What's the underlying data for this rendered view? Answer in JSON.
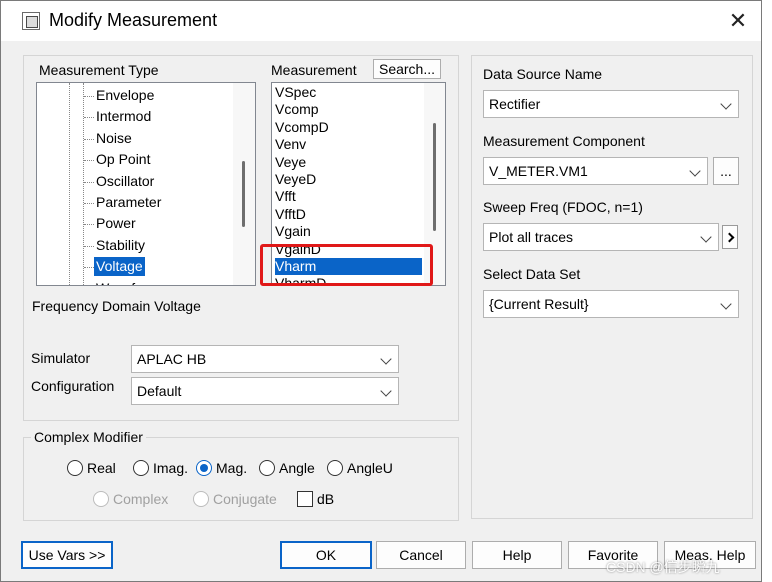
{
  "window": {
    "title": "Modify Measurement"
  },
  "measurement_type": {
    "label": "Measurement Type",
    "items": [
      "Envelope",
      "Intermod",
      "Noise",
      "Op Point",
      "Oscillator",
      "Parameter",
      "Power",
      "Stability",
      "Voltage",
      "Waveform"
    ],
    "selected": "Voltage",
    "selected_index": 8,
    "description": "Frequency Domain Voltage"
  },
  "measurement": {
    "label": "Measurement",
    "search_label": "Search...",
    "items": [
      "VSpec",
      "Vcomp",
      "VcompD",
      "Venv",
      "Veye",
      "VeyeD",
      "Vfft",
      "VfftD",
      "Vgain",
      "VgainD",
      "Vharm",
      "VharmD"
    ],
    "selected": "Vharm",
    "selected_index": 10
  },
  "simulator": {
    "label": "Simulator",
    "value": "APLAC HB"
  },
  "configuration": {
    "label": "Configuration",
    "value": "Default"
  },
  "complex_modifier": {
    "label": "Complex Modifier",
    "options": [
      "Real",
      "Imag.",
      "Mag.",
      "Angle",
      "AngleU"
    ],
    "selected": "Mag.",
    "disabled_options": [
      "Complex",
      "Conjugate"
    ],
    "db_label": "dB",
    "db_checked": false
  },
  "data_source": {
    "label": "Data Source Name",
    "value": "Rectifier"
  },
  "component": {
    "label": "Measurement Component",
    "value": "V_METER.VM1",
    "browse_label": "..."
  },
  "sweep": {
    "label": "Sweep Freq  (FDOC, n=1)",
    "value": "Plot all traces"
  },
  "data_set": {
    "label": "Select Data Set",
    "value": "{Current Result}"
  },
  "buttons": {
    "use_vars": "Use Vars >>",
    "ok": "OK",
    "cancel": "Cancel",
    "help": "Help",
    "favorite": "Favorite",
    "meas_help": "Meas. Help"
  },
  "watermark": "CSDN @信步瞬九",
  "colors": {
    "selection": "#0a64c8",
    "highlight_box": "#e01818",
    "dialog_bg": "#f0f0f0"
  }
}
